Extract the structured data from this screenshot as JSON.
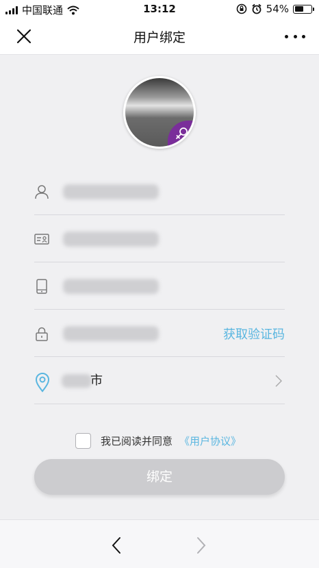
{
  "status_bar": {
    "carrier": "中国联通",
    "time": "13:12",
    "battery": "54%",
    "battery_level": 0.54,
    "icons": [
      "signal-icon",
      "wifi-icon",
      "orientation-lock-icon",
      "alarm-icon",
      "battery-icon"
    ]
  },
  "nav": {
    "title": "用户绑定",
    "close_icon": "close-icon",
    "more_icon": "more-icon"
  },
  "avatar": {
    "gender_icon": "female-icon",
    "badge_color": "#7a2e9a"
  },
  "form": {
    "name_row": {
      "icon": "user-icon"
    },
    "id_row": {
      "icon": "id-card-icon"
    },
    "phone_row": {
      "icon": "phone-icon"
    },
    "code_row": {
      "icon": "lock-icon",
      "get_code_label": "获取验证码"
    },
    "city_row": {
      "icon": "location-icon",
      "city_suffix": "市",
      "chevron_icon": "chevron-right-icon"
    }
  },
  "agreement": {
    "text": "我已阅读并同意",
    "link": "《用户协议》",
    "checked": false
  },
  "bind_button": {
    "label": "绑定"
  },
  "bottom_nav": {
    "back_icon": "back-arrow-icon",
    "forward_icon": "forward-arrow-icon"
  },
  "colors": {
    "accent": "#5ab6e0",
    "button_disabled": "#cccccf",
    "background": "#f0f0f2"
  }
}
